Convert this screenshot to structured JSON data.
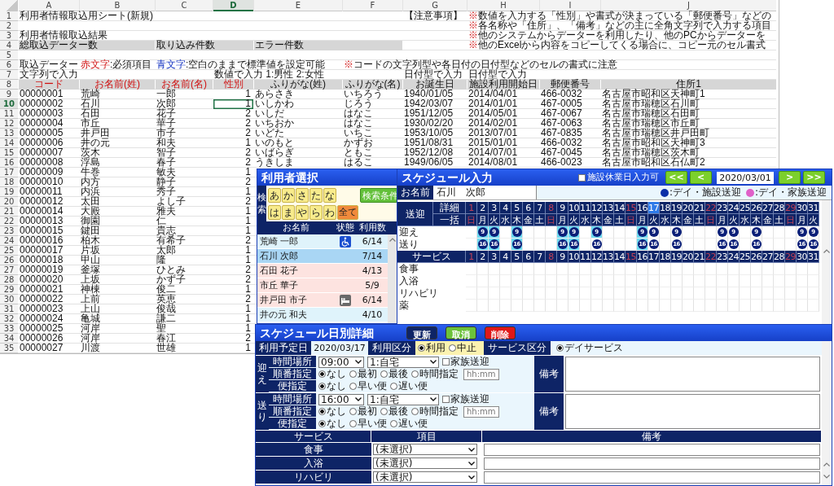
{
  "spreadsheet": {
    "columns": [
      {
        "label": "A",
        "selected": false,
        "numeric": false
      },
      {
        "label": "B",
        "selected": false,
        "numeric": false
      },
      {
        "label": "C",
        "selected": false,
        "numeric": false
      },
      {
        "label": "D",
        "selected": true,
        "numeric": true
      },
      {
        "label": "E",
        "selected": false,
        "numeric": false
      },
      {
        "label": "F",
        "selected": false,
        "numeric": false
      },
      {
        "label": "G",
        "selected": false,
        "numeric": false
      },
      {
        "label": "H",
        "selected": false,
        "numeric": false
      },
      {
        "label": "I",
        "selected": false,
        "numeric": false
      },
      {
        "label": "J",
        "selected": false,
        "numeric": false
      }
    ],
    "rows": [
      {
        "row": "1",
        "selected": false,
        "kind": "text",
        "cells": [
          "利用者情報取込用シート(新規)",
          null,
          null,
          null,
          null,
          null,
          "【注意事項】",
          {
            "parts": [
              {
                "text": "※",
                "kind": "warning"
              },
              {
                "text": "数値を入力する「性別」や書式が決まっている「郵便番号」などの"
              }
            ]
          },
          null,
          null
        ]
      },
      {
        "row": "2",
        "selected": false,
        "kind": "text",
        "cells": [
          null,
          null,
          null,
          null,
          null,
          null,
          null,
          {
            "parts": [
              {
                "text": "※",
                "kind": "warning"
              },
              {
                "text": "各名称や「住所」、「備考」などの主に全角文字列で入力する項目"
              }
            ]
          },
          null,
          null
        ]
      },
      {
        "row": "3",
        "selected": false,
        "kind": "text",
        "cells": [
          "利用者情報取込結果",
          null,
          null,
          null,
          null,
          null,
          null,
          {
            "parts": [
              {
                "text": "※",
                "kind": "warning"
              },
              {
                "text": "他のシステムからデーターを利用したり、他のPCからデーターを"
              }
            ]
          },
          null,
          null
        ]
      },
      {
        "row": "4",
        "selected": false,
        "kind": "text",
        "cells": [
          {
            "text": "総取込データー数",
            "kind": "label"
          },
          null,
          {
            "text": "取り込み件数",
            "kind": "label"
          },
          null,
          {
            "text": "エラー件数",
            "kind": "label"
          },
          null,
          null,
          {
            "parts": [
              {
                "text": "※",
                "kind": "warning"
              },
              {
                "text": "他のExcelから内容をコピーしてくる場合に、コピー元のセル書式"
              }
            ]
          },
          null,
          null
        ]
      },
      {
        "row": "5",
        "selected": false,
        "cells": [
          null,
          null,
          null,
          null,
          null,
          null,
          null,
          null,
          null,
          null
        ]
      },
      {
        "row": "6",
        "selected": false,
        "kind": "text",
        "cells": [
          "取込データー",
          {
            "parts": [
              {
                "text": "赤文字",
                "kind": "required"
              },
              {
                "text": ":必須項目"
              }
            ]
          },
          {
            "parts": [
              {
                "text": "青文字",
                "kind": "optional"
              },
              {
                "text": ":空白のままで標準値を設定可能"
              }
            ]
          },
          null,
          null,
          {
            "parts": [
              {
                "text": "※",
                "kind": "warning"
              },
              {
                "text": "コードの文字列型や各日付の日付型などのセルの書式に注意"
              }
            ]
          },
          null,
          null,
          null,
          null
        ]
      },
      {
        "row": "7",
        "selected": false,
        "kind": "text",
        "cells": [
          "文字列で入力",
          null,
          null,
          "数値で入力 1:男性 2:女性",
          null,
          null,
          "日付型で入力",
          "日付型で入力",
          null,
          null
        ]
      },
      {
        "row": "8",
        "selected": false,
        "kind": "header",
        "cells": [
          {
            "text": "コード",
            "required": true
          },
          {
            "text": "お名前(姓)",
            "required": true
          },
          {
            "text": "お名前(名)",
            "required": true
          },
          {
            "text": "性別",
            "required": true
          },
          {
            "text": "ふりがな(姓)",
            "required": false
          },
          {
            "text": "ふりがな(名)",
            "required": false
          },
          {
            "text": "お誕生日",
            "required": false
          },
          {
            "text": "施設利用開始日",
            "required": false
          },
          {
            "text": "郵便番号",
            "required": false
          },
          {
            "text": "住所1",
            "required": false
          }
        ]
      }
    ],
    "records": [
      {
        "row": "9",
        "selected": false,
        "cells": [
          "00000001",
          "荒崎",
          "一郎",
          "1",
          "あらさき",
          "いちろう",
          "1940/01/05",
          "2014/04/01",
          "466-0032",
          "名古屋市昭和区天神町1"
        ]
      },
      {
        "row": "10",
        "selected": true,
        "cells": [
          "00000002",
          "石川",
          "次郎",
          "1",
          "いしかわ",
          "じろう",
          "1942/03/07",
          "2014/01/01",
          "467-0005",
          "名古屋市瑞穂区石川町"
        ]
      },
      {
        "row": "11",
        "selected": false,
        "cells": [
          "00000003",
          "石田",
          "花子",
          "2",
          "いしだ",
          "はなこ",
          "1951/12/05",
          "2014/05/01",
          "467-0067",
          "名古屋市瑞穂区石田町"
        ]
      },
      {
        "row": "12",
        "selected": false,
        "cells": [
          "00000004",
          "市丘",
          "華子",
          "2",
          "いちおか",
          "はなこ",
          "1930/02/20",
          "2014/02/01",
          "467-0063",
          "名古屋市瑞穂区市丘町"
        ]
      },
      {
        "row": "13",
        "selected": false,
        "cells": [
          "00000005",
          "井戸田",
          "市子",
          "2",
          "いどた",
          "いちこ",
          "1953/10/05",
          "2013/07/01",
          "467-0835",
          "名古屋市瑞穂区井戸田町"
        ]
      },
      {
        "row": "14",
        "selected": false,
        "cells": [
          "00000006",
          "井の元",
          "和夫",
          "1",
          "いのもと",
          "かずお",
          "1951/08/31",
          "2015/01/01",
          "466-0032",
          "名古屋市昭和区天神町3"
        ]
      },
      {
        "row": "15",
        "selected": false,
        "cells": [
          "00000007",
          "茨木",
          "智子",
          "2",
          "いばらぎ",
          "ともこ",
          "1952/12/08",
          "2014/07/01",
          "467-0045",
          "名古屋市瑞穂区茨木町"
        ]
      },
      {
        "row": "16",
        "selected": false,
        "cells": [
          "00000008",
          "浮島",
          "春子",
          "2",
          "うきしま",
          "はるこ",
          "1949/06/05",
          "2014/08/01",
          "466-0023",
          "名古屋市昭和区石仏町2"
        ]
      },
      {
        "row": "17",
        "selected": false,
        "cells": [
          "00000009",
          "牛巻",
          "敏夫",
          "1"
        ]
      },
      {
        "row": "18",
        "selected": false,
        "cells": [
          "00000010",
          "内方",
          "静子",
          "2"
        ]
      },
      {
        "row": "19",
        "selected": false,
        "cells": [
          "00000011",
          "内浜",
          "秀子",
          "1"
        ]
      },
      {
        "row": "20",
        "selected": false,
        "cells": [
          "00000012",
          "太田",
          "よし子",
          "2"
        ]
      },
      {
        "row": "21",
        "selected": false,
        "cells": [
          "00000014",
          "大殿",
          "雅夫",
          "1"
        ]
      },
      {
        "row": "22",
        "selected": false,
        "cells": [
          "00000013",
          "御園",
          "仁",
          "1"
        ]
      },
      {
        "row": "23",
        "selected": false,
        "cells": [
          "00000015",
          "鍵田",
          "貴志",
          "1"
        ]
      },
      {
        "row": "24",
        "selected": false,
        "cells": [
          "00000016",
          "柏木",
          "有希子",
          "2"
        ]
      },
      {
        "row": "25",
        "selected": false,
        "cells": [
          "00000017",
          "片坂",
          "太郎",
          "1"
        ]
      },
      {
        "row": "26",
        "selected": false,
        "cells": [
          "00000018",
          "甲山",
          "隆",
          "1"
        ]
      },
      {
        "row": "27",
        "selected": false,
        "cells": [
          "00000019",
          "釜塚",
          "ひとみ",
          "2"
        ]
      },
      {
        "row": "28",
        "selected": false,
        "cells": [
          "00000020",
          "上坂",
          "かず子",
          "2"
        ]
      },
      {
        "row": "29",
        "selected": false,
        "cells": [
          "00000021",
          "神棟",
          "俊二",
          "1"
        ]
      },
      {
        "row": "30",
        "selected": false,
        "cells": [
          "00000022",
          "上前",
          "英恵",
          "2"
        ]
      },
      {
        "row": "31",
        "selected": false,
        "cells": [
          "00000023",
          "上山",
          "俊哉",
          "1"
        ]
      },
      {
        "row": "32",
        "selected": false,
        "cells": [
          "00000024",
          "亀城",
          "謙二",
          "1"
        ]
      },
      {
        "row": "33",
        "selected": false,
        "cells": [
          "00000025",
          "河岸",
          "聖",
          "1"
        ]
      },
      {
        "row": "34",
        "selected": false,
        "cells": [
          "00000026",
          "河岸",
          "春江",
          "2"
        ]
      },
      {
        "row": "35",
        "selected": false,
        "cells": [
          "00000027",
          "川渡",
          "世雄",
          "1"
        ]
      }
    ]
  },
  "user_select": {
    "title": "利用者選択",
    "search_label": "検索",
    "kana_rows": [
      [
        {
          "label": "あ",
          "kind": "kana"
        },
        {
          "label": "か",
          "kind": "kana"
        },
        {
          "label": "さ",
          "kind": "kana"
        },
        {
          "label": "た",
          "kind": "kana"
        },
        {
          "label": "な",
          "kind": "kana"
        }
      ],
      [
        {
          "label": "は",
          "kind": "kana"
        },
        {
          "label": "ま",
          "kind": "kana"
        },
        {
          "label": "や",
          "kind": "kana"
        },
        {
          "label": "ら",
          "kind": "kana"
        },
        {
          "label": "わ",
          "kind": "kana"
        },
        {
          "label": "全て",
          "kind": "all"
        }
      ]
    ],
    "condition_button": "検索条件",
    "columns": [
      "お名前",
      "状態",
      "利用数"
    ],
    "users": [
      {
        "name": "荒崎 一郎",
        "kind": "wheelchair",
        "count": "6/14",
        "color": "#dff3fb",
        "selected": false
      },
      {
        "name": "石川 次郎",
        "kind": "plain",
        "count": "7/14",
        "selected": true
      },
      {
        "name": "石田 花子",
        "kind": "plain",
        "count": "4/13",
        "color": "#fde3e0",
        "selected": false
      },
      {
        "name": "市丘 華子",
        "kind": "plain",
        "count": "5/9",
        "color": "#fde3e0",
        "selected": false
      },
      {
        "name": "井戸田 市子",
        "kind": "bed",
        "count": "6/14",
        "color": "#fde3e0",
        "selected": false
      },
      {
        "name": "井の元 和夫",
        "kind": "plain",
        "count": "4/10",
        "color": "#dff3fb",
        "selected": false
      }
    ]
  },
  "schedule": {
    "title": "スケジュール入力",
    "closed_day_label": "施設休業日入力可",
    "closed_day_checked": false,
    "nav_before": [
      "<<",
      "<"
    ],
    "date": "2020/03/01",
    "nav_after": [
      ">",
      ">>"
    ],
    "name_label": "お名前",
    "name": "石川　次郎",
    "legend": [
      {
        "label": ":デイ・施設送迎",
        "color": "#0b2fa8"
      },
      {
        "label": ":デイ・家族送迎",
        "color": "#e060c8"
      }
    ],
    "transport_label": "送迎",
    "detail_label": "詳細",
    "bulk_label": "一括",
    "pickup_label": "迎え",
    "dropoff_label": "送り",
    "days": [
      {
        "day": "1",
        "weekday": "日",
        "sunday": true,
        "selected": false
      },
      {
        "day": "2",
        "weekday": "月",
        "sunday": false,
        "selected": false,
        "pickup": "9",
        "pickup_highlight": true,
        "dropoff": "16",
        "dropoff_highlight": true
      },
      {
        "day": "3",
        "weekday": "火",
        "sunday": false,
        "selected": false,
        "pickup": "9",
        "pickup_highlight": true,
        "dropoff": "16",
        "dropoff_highlight": true
      },
      {
        "day": "4",
        "weekday": "水",
        "sunday": false,
        "selected": false
      },
      {
        "day": "5",
        "weekday": "木",
        "sunday": false,
        "selected": false,
        "pickup": "9",
        "pickup_highlight": true,
        "dropoff": "16",
        "dropoff_highlight": true
      },
      {
        "day": "6",
        "weekday": "金",
        "sunday": false,
        "selected": false
      },
      {
        "day": "7",
        "weekday": "土",
        "sunday": false,
        "selected": false
      },
      {
        "day": "8",
        "weekday": "日",
        "sunday": true,
        "selected": false
      },
      {
        "day": "9",
        "weekday": "月",
        "sunday": false,
        "selected": false,
        "pickup": "9",
        "pickup_highlight": true,
        "dropoff": "16",
        "dropoff_highlight": true
      },
      {
        "day": "10",
        "weekday": "火",
        "sunday": false,
        "selected": false,
        "pickup": "9",
        "pickup_highlight": true,
        "dropoff": "16",
        "dropoff_highlight": true
      },
      {
        "day": "11",
        "weekday": "水",
        "sunday": false,
        "selected": false
      },
      {
        "day": "12",
        "weekday": "木",
        "sunday": false,
        "selected": false,
        "pickup": "9",
        "pickup_highlight": true,
        "dropoff": "16",
        "dropoff_highlight": false
      },
      {
        "day": "13",
        "weekday": "金",
        "sunday": false,
        "selected": false
      },
      {
        "day": "14",
        "weekday": "土",
        "sunday": false,
        "selected": false
      },
      {
        "day": "15",
        "weekday": "日",
        "sunday": true,
        "selected": false
      },
      {
        "day": "16",
        "weekday": "月",
        "sunday": false,
        "selected": false,
        "pickup": "9",
        "pickup_highlight": true,
        "dropoff": "16",
        "dropoff_highlight": true
      },
      {
        "day": "17",
        "weekday": "火",
        "sunday": false,
        "selected": true,
        "pickup": "9",
        "pickup_highlight": false,
        "dropoff": "16",
        "dropoff_highlight": false
      },
      {
        "day": "18",
        "weekday": "水",
        "sunday": false,
        "selected": false
      },
      {
        "day": "19",
        "weekday": "木",
        "sunday": false,
        "selected": false,
        "pickup": "9",
        "pickup_highlight": false,
        "dropoff": "16",
        "dropoff_highlight": false
      },
      {
        "day": "20",
        "weekday": "金",
        "sunday": false,
        "selected": false
      },
      {
        "day": "21",
        "weekday": "土",
        "sunday": false,
        "selected": false
      },
      {
        "day": "22",
        "weekday": "日",
        "sunday": true,
        "selected": false
      },
      {
        "day": "23",
        "weekday": "月",
        "sunday": false,
        "selected": false,
        "pickup": "9",
        "pickup_highlight": false,
        "dropoff": "16",
        "dropoff_highlight": false
      },
      {
        "day": "24",
        "weekday": "火",
        "sunday": false,
        "selected": false,
        "pickup": "9",
        "pickup_highlight": false,
        "dropoff": "16",
        "dropoff_highlight": false
      },
      {
        "day": "25",
        "weekday": "水",
        "sunday": false,
        "selected": false
      },
      {
        "day": "26",
        "weekday": "木",
        "sunday": false,
        "selected": false,
        "pickup": "9",
        "pickup_highlight": false,
        "dropoff": "16",
        "dropoff_highlight": false
      },
      {
        "day": "27",
        "weekday": "金",
        "sunday": false,
        "selected": false
      },
      {
        "day": "28",
        "weekday": "土",
        "sunday": false,
        "selected": false
      },
      {
        "day": "29",
        "weekday": "日",
        "sunday": true,
        "selected": false
      },
      {
        "day": "30",
        "weekday": "月",
        "sunday": false,
        "selected": false,
        "pickup": "9",
        "pickup_highlight": false,
        "dropoff": "16",
        "dropoff_highlight": false
      },
      {
        "day": "31",
        "weekday": "火",
        "sunday": false,
        "selected": false,
        "pickup": "9",
        "pickup_highlight": false,
        "dropoff": "16",
        "dropoff_highlight": false
      }
    ],
    "service_label": "サービス",
    "service_days": [
      "1",
      "2",
      "3",
      "4",
      "5",
      "6",
      "7",
      "8",
      "9",
      "10",
      "11",
      "12",
      "13",
      "14",
      "15",
      "16",
      "17",
      "18",
      "19",
      "20",
      "21",
      "22",
      "23",
      "24",
      "25",
      "26",
      "27",
      "28",
      "29",
      "30",
      "31"
    ],
    "service_rows": [
      "食事",
      "入浴",
      "リハビリ",
      "薬"
    ]
  },
  "detail": {
    "title": "スケジュール日別詳細",
    "buttons": [
      {
        "label": "更新",
        "kind": "update"
      },
      {
        "label": "取消",
        "kind": "cancel"
      },
      {
        "label": "削除",
        "kind": "delete"
      }
    ],
    "date_label": "利用予定日",
    "date": "2020/03/17",
    "usage_label": "利用区分",
    "usage_options": [
      {
        "label": "利用",
        "selected": true
      },
      {
        "label": "中止",
        "selected": false
      }
    ],
    "service_type_label": "サービス区分",
    "service_type_options": [
      {
        "label": "デイサービス",
        "selected": true
      }
    ],
    "transports": [
      {
        "label": "迎え",
        "time_place_label": "時間場所",
        "time": "09:00",
        "place": "1:自宅",
        "family_label": "家族送迎",
        "family_checked": false,
        "order_label": "順番指定",
        "order_options": [
          {
            "label": "なし",
            "selected": true
          },
          {
            "label": "最初",
            "selected": false
          },
          {
            "label": "最後",
            "selected": false
          },
          {
            "label": "時間指定",
            "selected": false
          }
        ],
        "time_placeholder": "hh:mm",
        "flight_label": "便指定",
        "flight_options": [
          {
            "label": "なし",
            "selected": true
          },
          {
            "label": "早い便",
            "selected": false
          },
          {
            "label": "遅い便",
            "selected": false
          }
        ],
        "note_label": "備考"
      },
      {
        "label": "送り",
        "time_place_label": "時間場所",
        "time": "16:00",
        "place": "1:自宅",
        "family_label": "家族送迎",
        "family_checked": false,
        "order_label": "順番指定",
        "order_options": [
          {
            "label": "なし",
            "selected": true
          },
          {
            "label": "最初",
            "selected": false
          },
          {
            "label": "最後",
            "selected": false
          },
          {
            "label": "時間指定",
            "selected": false
          }
        ],
        "time_placeholder": "hh:mm",
        "flight_label": "便指定",
        "flight_options": [
          {
            "label": "なし",
            "selected": true
          },
          {
            "label": "早い便",
            "selected": false
          },
          {
            "label": "遅い便",
            "selected": false
          }
        ],
        "note_label": "備考"
      }
    ],
    "services": {
      "columns": [
        "サービス",
        "項目",
        "備考"
      ],
      "rows": [
        {
          "label": "食事",
          "item": "(未選択)"
        },
        {
          "label": "入浴",
          "item": "(未選択)"
        },
        {
          "label": "リハビリ",
          "item": "(未選択)"
        }
      ]
    }
  }
}
